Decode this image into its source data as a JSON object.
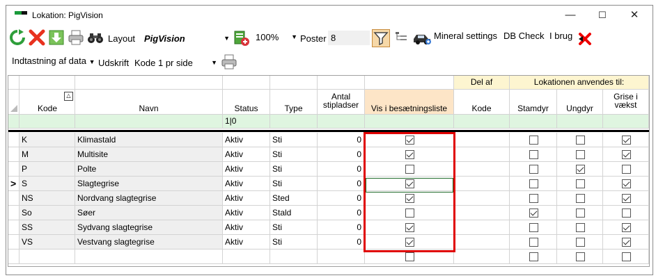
{
  "window": {
    "title": "Lokation: PigVision",
    "minimize_glyph": "—",
    "maximize_glyph": "☐",
    "close_glyph": "✕"
  },
  "toolbar": {
    "layout_label": "Layout",
    "layout_value": "PigVision",
    "zoom_value": "100%",
    "poster_label": "Poster",
    "poster_value": "8",
    "mineral_settings": "Mineral settings",
    "db_check": "DB Check",
    "i_brug": "I brug",
    "indtastning_label": "Indtastning af data",
    "udskrift_label": "Udskrift",
    "udskrift_value": "Kode 1 pr side",
    "icons": [
      "refresh-icon",
      "delete-icon",
      "download-icon",
      "print-icon",
      "binoculars-icon",
      "export-icon",
      "filter-icon",
      "tree-icon",
      "car-icon",
      "red-x-icon"
    ]
  },
  "grid": {
    "group_headers": {
      "del_af": "Del af",
      "lokationen": "Lokationen anvendes til:"
    },
    "columns": {
      "kode": "Kode",
      "navn": "Navn",
      "status": "Status",
      "type": "Type",
      "antal": "Antal stipladser",
      "vis": "Vis i besætningsliste",
      "del_kode": "Kode",
      "stamdyr": "Stamdyr",
      "ungdyr": "Ungdyr",
      "grise": "Grise i vækst"
    },
    "filter_status": "1|0",
    "row_indicator": ">",
    "rows": [
      {
        "kode": "K",
        "navn": "Klimastald",
        "status": "Aktiv",
        "type": "Sti",
        "antal": "0",
        "vis": true,
        "stamdyr": false,
        "ungdyr": false,
        "grise": true
      },
      {
        "kode": "M",
        "navn": "Multisite",
        "status": "Aktiv",
        "type": "Sti",
        "antal": "0",
        "vis": true,
        "stamdyr": false,
        "ungdyr": false,
        "grise": true
      },
      {
        "kode": "P",
        "navn": "Polte",
        "status": "Aktiv",
        "type": "Sti",
        "antal": "0",
        "vis": false,
        "stamdyr": false,
        "ungdyr": true,
        "grise": false
      },
      {
        "kode": "S",
        "navn": "Slagtegrise",
        "status": "Aktiv",
        "type": "Sti",
        "antal": "0",
        "vis": true,
        "stamdyr": false,
        "ungdyr": false,
        "grise": true
      },
      {
        "kode": "NS",
        "navn": "Nordvang slagtegrise",
        "status": "Aktiv",
        "type": "Sted",
        "antal": "0",
        "vis": true,
        "stamdyr": false,
        "ungdyr": false,
        "grise": true
      },
      {
        "kode": "So",
        "navn": "Søer",
        "status": "Aktiv",
        "type": "Stald",
        "antal": "0",
        "vis": false,
        "stamdyr": true,
        "ungdyr": false,
        "grise": false
      },
      {
        "kode": "SS",
        "navn": "Sydvang slagtegrise",
        "status": "Aktiv",
        "type": "Sti",
        "antal": "0",
        "vis": true,
        "stamdyr": false,
        "ungdyr": false,
        "grise": true
      },
      {
        "kode": "VS",
        "navn": "Vestvang slagtegrise",
        "status": "Aktiv",
        "type": "Sti",
        "antal": "0",
        "vis": true,
        "stamdyr": false,
        "ungdyr": false,
        "grise": true
      }
    ],
    "new_row": {
      "vis": false,
      "stamdyr": false,
      "ungdyr": false,
      "grise": false
    },
    "current_row_index": 3
  },
  "colors": {
    "highlight_box": "#e00000",
    "orange_header": "#fde5c7",
    "filter_row": "#dff5e0"
  }
}
